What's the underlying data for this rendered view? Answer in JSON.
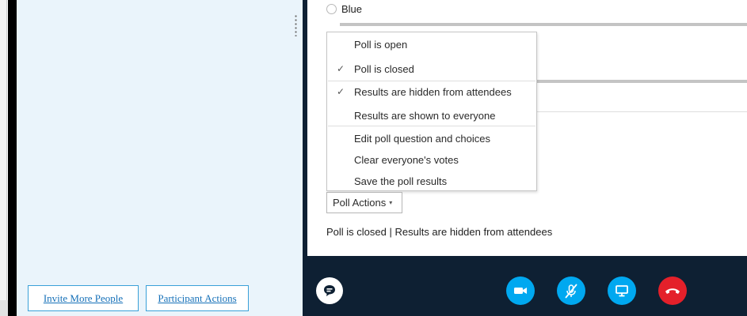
{
  "poll": {
    "choice_label": "Blue",
    "status_text": "Poll is closed  |  Results are hidden from attendees"
  },
  "menu": {
    "items": [
      {
        "label": "Poll is open",
        "checked": false
      },
      {
        "label": "Poll is closed",
        "checked": true
      },
      {
        "label": "Results are hidden from attendees",
        "checked": true
      },
      {
        "label": "Results are shown to everyone",
        "checked": false
      },
      {
        "label": "Edit poll question and choices",
        "checked": false
      },
      {
        "label": "Clear everyone's votes",
        "checked": false
      },
      {
        "label": "Save the poll results",
        "checked": false
      }
    ],
    "check_glyph": "✓"
  },
  "poll_actions": {
    "label": "Poll Actions",
    "caret": "▾"
  },
  "participants": {
    "invite_label": "Invite More People",
    "actions_label": "Participant Actions"
  },
  "controls": [
    {
      "name": "chat-icon",
      "color": "#ffffff"
    },
    {
      "name": "video-camera-icon",
      "color": "#00a8f0"
    },
    {
      "name": "microphone-muted-icon",
      "color": "#00a8f0"
    },
    {
      "name": "present-screen-icon",
      "color": "#00a8f0"
    },
    {
      "name": "hang-up-icon",
      "color": "#e4202a"
    }
  ],
  "colors": {
    "accent": "#00a8f0",
    "hangup": "#e4202a",
    "dark_background": "#0e2033",
    "pane_background": "#eaf4fb",
    "link": "#1570b8"
  }
}
